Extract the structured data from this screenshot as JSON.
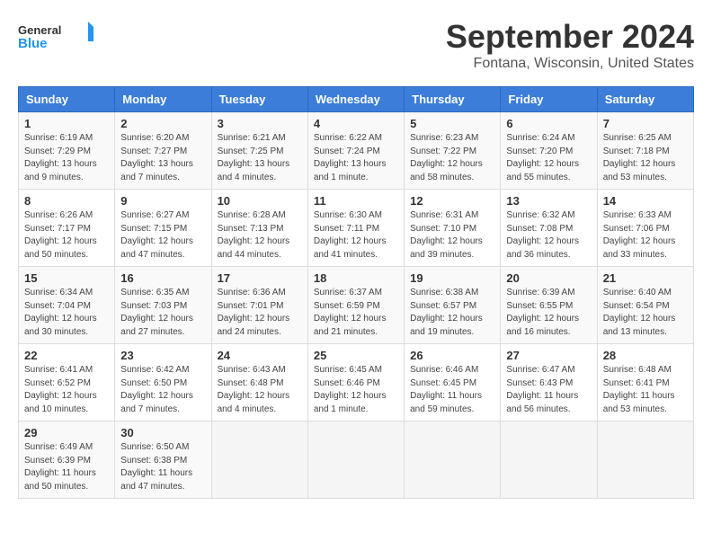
{
  "logo": {
    "line1": "General",
    "line2": "Blue"
  },
  "title": "September 2024",
  "location": "Fontana, Wisconsin, United States",
  "days_of_week": [
    "Sunday",
    "Monday",
    "Tuesday",
    "Wednesday",
    "Thursday",
    "Friday",
    "Saturday"
  ],
  "weeks": [
    [
      {
        "day": "1",
        "info": "Sunrise: 6:19 AM\nSunset: 7:29 PM\nDaylight: 13 hours\nand 9 minutes."
      },
      {
        "day": "2",
        "info": "Sunrise: 6:20 AM\nSunset: 7:27 PM\nDaylight: 13 hours\nand 7 minutes."
      },
      {
        "day": "3",
        "info": "Sunrise: 6:21 AM\nSunset: 7:25 PM\nDaylight: 13 hours\nand 4 minutes."
      },
      {
        "day": "4",
        "info": "Sunrise: 6:22 AM\nSunset: 7:24 PM\nDaylight: 13 hours\nand 1 minute."
      },
      {
        "day": "5",
        "info": "Sunrise: 6:23 AM\nSunset: 7:22 PM\nDaylight: 12 hours\nand 58 minutes."
      },
      {
        "day": "6",
        "info": "Sunrise: 6:24 AM\nSunset: 7:20 PM\nDaylight: 12 hours\nand 55 minutes."
      },
      {
        "day": "7",
        "info": "Sunrise: 6:25 AM\nSunset: 7:18 PM\nDaylight: 12 hours\nand 53 minutes."
      }
    ],
    [
      {
        "day": "8",
        "info": "Sunrise: 6:26 AM\nSunset: 7:17 PM\nDaylight: 12 hours\nand 50 minutes."
      },
      {
        "day": "9",
        "info": "Sunrise: 6:27 AM\nSunset: 7:15 PM\nDaylight: 12 hours\nand 47 minutes."
      },
      {
        "day": "10",
        "info": "Sunrise: 6:28 AM\nSunset: 7:13 PM\nDaylight: 12 hours\nand 44 minutes."
      },
      {
        "day": "11",
        "info": "Sunrise: 6:30 AM\nSunset: 7:11 PM\nDaylight: 12 hours\nand 41 minutes."
      },
      {
        "day": "12",
        "info": "Sunrise: 6:31 AM\nSunset: 7:10 PM\nDaylight: 12 hours\nand 39 minutes."
      },
      {
        "day": "13",
        "info": "Sunrise: 6:32 AM\nSunset: 7:08 PM\nDaylight: 12 hours\nand 36 minutes."
      },
      {
        "day": "14",
        "info": "Sunrise: 6:33 AM\nSunset: 7:06 PM\nDaylight: 12 hours\nand 33 minutes."
      }
    ],
    [
      {
        "day": "15",
        "info": "Sunrise: 6:34 AM\nSunset: 7:04 PM\nDaylight: 12 hours\nand 30 minutes."
      },
      {
        "day": "16",
        "info": "Sunrise: 6:35 AM\nSunset: 7:03 PM\nDaylight: 12 hours\nand 27 minutes."
      },
      {
        "day": "17",
        "info": "Sunrise: 6:36 AM\nSunset: 7:01 PM\nDaylight: 12 hours\nand 24 minutes."
      },
      {
        "day": "18",
        "info": "Sunrise: 6:37 AM\nSunset: 6:59 PM\nDaylight: 12 hours\nand 21 minutes."
      },
      {
        "day": "19",
        "info": "Sunrise: 6:38 AM\nSunset: 6:57 PM\nDaylight: 12 hours\nand 19 minutes."
      },
      {
        "day": "20",
        "info": "Sunrise: 6:39 AM\nSunset: 6:55 PM\nDaylight: 12 hours\nand 16 minutes."
      },
      {
        "day": "21",
        "info": "Sunrise: 6:40 AM\nSunset: 6:54 PM\nDaylight: 12 hours\nand 13 minutes."
      }
    ],
    [
      {
        "day": "22",
        "info": "Sunrise: 6:41 AM\nSunset: 6:52 PM\nDaylight: 12 hours\nand 10 minutes."
      },
      {
        "day": "23",
        "info": "Sunrise: 6:42 AM\nSunset: 6:50 PM\nDaylight: 12 hours\nand 7 minutes."
      },
      {
        "day": "24",
        "info": "Sunrise: 6:43 AM\nSunset: 6:48 PM\nDaylight: 12 hours\nand 4 minutes."
      },
      {
        "day": "25",
        "info": "Sunrise: 6:45 AM\nSunset: 6:46 PM\nDaylight: 12 hours\nand 1 minute."
      },
      {
        "day": "26",
        "info": "Sunrise: 6:46 AM\nSunset: 6:45 PM\nDaylight: 11 hours\nand 59 minutes."
      },
      {
        "day": "27",
        "info": "Sunrise: 6:47 AM\nSunset: 6:43 PM\nDaylight: 11 hours\nand 56 minutes."
      },
      {
        "day": "28",
        "info": "Sunrise: 6:48 AM\nSunset: 6:41 PM\nDaylight: 11 hours\nand 53 minutes."
      }
    ],
    [
      {
        "day": "29",
        "info": "Sunrise: 6:49 AM\nSunset: 6:39 PM\nDaylight: 11 hours\nand 50 minutes."
      },
      {
        "day": "30",
        "info": "Sunrise: 6:50 AM\nSunset: 6:38 PM\nDaylight: 11 hours\nand 47 minutes."
      },
      {
        "day": "",
        "info": ""
      },
      {
        "day": "",
        "info": ""
      },
      {
        "day": "",
        "info": ""
      },
      {
        "day": "",
        "info": ""
      },
      {
        "day": "",
        "info": ""
      }
    ]
  ]
}
